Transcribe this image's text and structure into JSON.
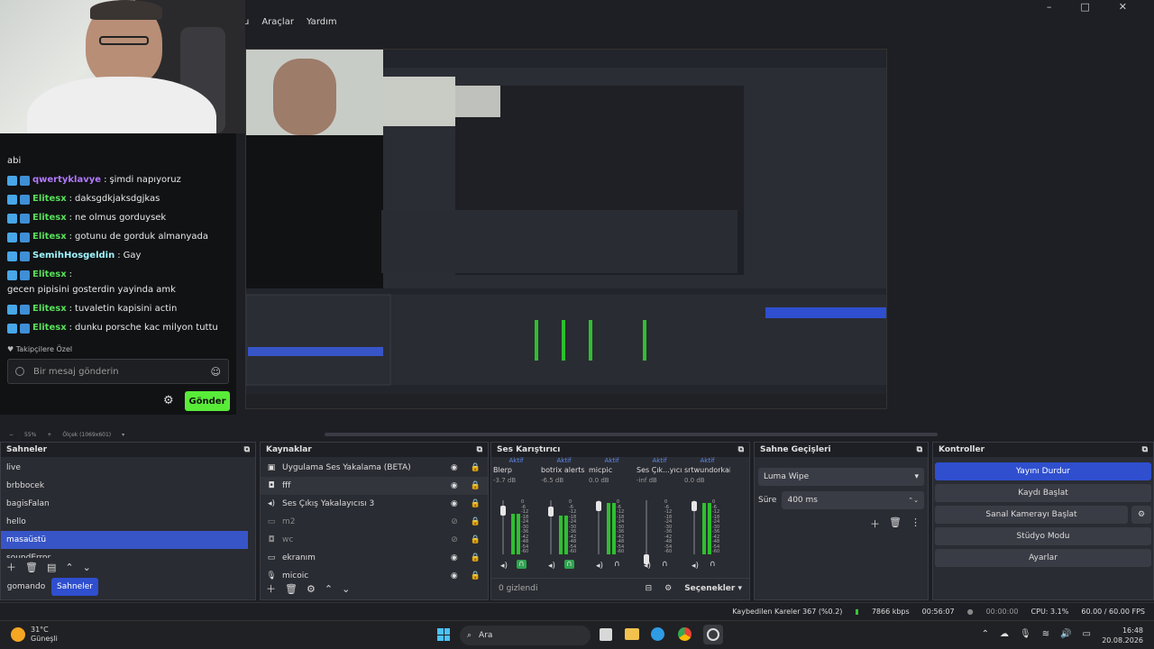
{
  "menu": [
    "u",
    "Araçlar",
    "Yardım"
  ],
  "window_controls": [
    "–",
    "□",
    "✕"
  ],
  "chat": {
    "partial_top": "abi",
    "messages": [
      {
        "user": "qwertyklavye",
        "text": "şimdi napıyoruz",
        "color": "#b279ff"
      },
      {
        "user": "Elitesx",
        "text": "daksgdkjaksdgjkas",
        "color": "#58e05a"
      },
      {
        "user": "Elitesx",
        "text": "ne olmus gorduysek",
        "color": "#58e05a"
      },
      {
        "user": "Elitesx",
        "text": "gotunu de gorduk almanyada",
        "color": "#58e05a"
      },
      {
        "user": "SemihHosgeldin",
        "text": "Gay",
        "color": "#9ff5ff"
      },
      {
        "user": "Elitesx",
        "text": "gecen pipisini gosterdin yayinda amk",
        "color": "#58e05a"
      },
      {
        "user": "Elitesx",
        "text": "tuvaletin kapisini actin",
        "color": "#58e05a"
      },
      {
        "user": "Elitesx",
        "text": "dunku porsche kac milyon tuttu",
        "color": "#58e05a"
      }
    ],
    "followers_label": "♥ Takipçilere Özel",
    "input_placeholder": "Bir mesaj gönderin",
    "send_label": "Gönder"
  },
  "preview_bar": {
    "zoom": "55%",
    "scale": "Ölçek (1069x601)"
  },
  "scenes": {
    "title": "Sahneler",
    "items": [
      "live",
      "brbbocek",
      "bagisFalan",
      "hello",
      "masaüstü",
      "soundError"
    ],
    "selected_index": 4,
    "tabs": [
      "gomando",
      "Sahneler"
    ]
  },
  "sources": {
    "title": "Kaynaklar",
    "items": [
      {
        "name": "Uygulama Ses Yakalama (BETA)",
        "icon": "app-audio-icon",
        "visible": true
      },
      {
        "name": "fff",
        "icon": "camera-icon",
        "visible": true
      },
      {
        "name": "Ses Çıkış Yakalayıcısı 3",
        "icon": "speaker-icon",
        "visible": true
      },
      {
        "name": "m2",
        "icon": "monitor-icon",
        "visible": false
      },
      {
        "name": "wc",
        "icon": "camera-icon",
        "visible": false
      },
      {
        "name": "ekranım",
        "icon": "monitor-icon",
        "visible": true
      },
      {
        "name": "micoic",
        "icon": "mic-icon",
        "visible": true
      }
    ]
  },
  "mixer": {
    "title": "Ses Karıştırıcı",
    "channels": [
      {
        "status": "Aktif",
        "name": "Blerp",
        "db": "-3.7 dB",
        "level": 0.75
      },
      {
        "status": "Aktif",
        "name": "botrix alerts",
        "db": "-6.5 dB",
        "level": 0.72
      },
      {
        "status": "Aktif",
        "name": "micpic",
        "db": "0.0 dB",
        "level": 0.95
      },
      {
        "status": "Aktif",
        "name": "Ses Çık...yıcısı 3",
        "db": "-inf dB",
        "level": 0.0
      },
      {
        "status": "Aktif",
        "name": "srtwundorkai",
        "db": "0.0 dB",
        "level": 0.95
      }
    ],
    "scale": [
      "0",
      "-6",
      "-12",
      "-18",
      "-24",
      "-30",
      "-36",
      "-42",
      "-48",
      "-54",
      "-60"
    ],
    "hidden_label": "0 gizlendi",
    "options_label": "Seçenekler ▾"
  },
  "transitions": {
    "title": "Sahne Geçişleri",
    "selected": "Luma Wipe",
    "duration_label": "Süre",
    "duration_value": "400 ms"
  },
  "controls": {
    "title": "Kontroller",
    "buttons": [
      "Yayını Durdur",
      "Kaydı Başlat",
      "Sanal Kamerayı Başlat",
      "Stüdyo Modu",
      "Ayarlar"
    ]
  },
  "status": {
    "dropped": "Kaybedilen Kareler 367 (%0.2)",
    "bitrate": "7866 kbps",
    "stream_time": "00:56:07",
    "rec_time": "00:00:00",
    "cpu": "CPU: 3.1%",
    "fps": "60.00 / 60.00 FPS"
  },
  "taskbar": {
    "weather_temp": "31°C",
    "weather_desc": "Güneşli",
    "search": "Ara",
    "time": "16:48",
    "date": "20.08.2026"
  }
}
